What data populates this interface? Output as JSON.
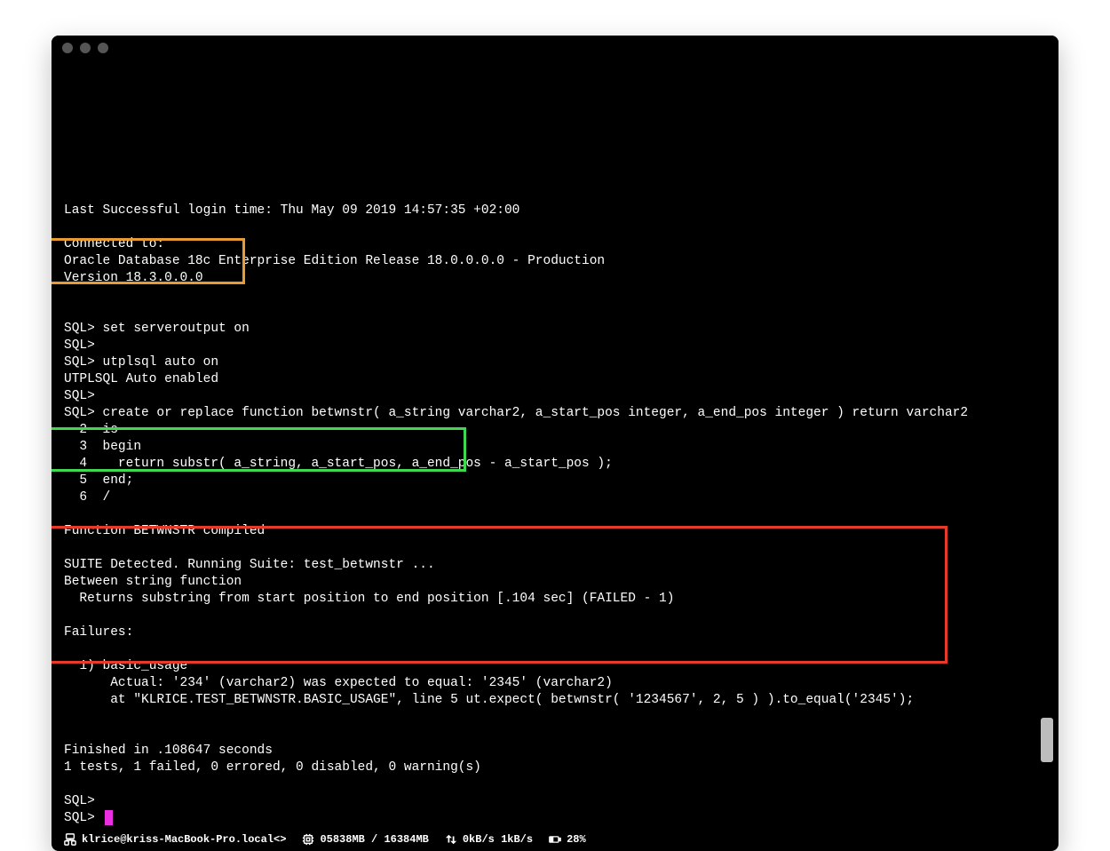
{
  "window": {
    "traffic_dots": 3
  },
  "terminal": {
    "lines": [
      "",
      "Last Successful login time: Thu May 09 2019 14:57:35 +02:00",
      "",
      "Connected to:",
      "Oracle Database 18c Enterprise Edition Release 18.0.0.0.0 - Production",
      "Version 18.3.0.0.0",
      "",
      "",
      "SQL> set serveroutput on",
      "SQL>",
      "SQL> utplsql auto on",
      "UTPLSQL Auto enabled",
      "SQL>",
      "SQL> create or replace function betwnstr( a_string varchar2, a_start_pos integer, a_end_pos integer ) return varchar2",
      "  2  is",
      "  3  begin",
      "  4    return substr( a_string, a_start_pos, a_end_pos - a_start_pos );",
      "  5  end;",
      "  6  /",
      "",
      "Function BETWNSTR compiled",
      "",
      "SUITE Detected. Running Suite: test_betwnstr ...",
      "Between string function",
      "  Returns substring from start position to end position [.104 sec] (FAILED - 1)",
      "",
      "Failures:",
      "",
      "  1) basic_usage",
      "      Actual: '234' (varchar2) was expected to equal: '2345' (varchar2)",
      "      at \"KLRICE.TEST_BETWNSTR.BASIC_USAGE\", line 5 ut.expect( betwnstr( '1234567', 2, 5 ) ).to_equal('2345');",
      "",
      "",
      "Finished in .108647 seconds",
      "1 tests, 1 failed, 0 errored, 0 disabled, 0 warning(s)",
      "",
      "SQL>",
      "SQL> "
    ],
    "cursor_visible": true
  },
  "highlights": {
    "orange": {
      "top_line": 10,
      "height_lines": 3,
      "label": "utplsql-auto-enable"
    },
    "green": {
      "top_line": 22,
      "height_lines": 2,
      "label": "suite-detected"
    },
    "red": {
      "top_line": 28,
      "height_lines": 8,
      "label": "failure-output"
    }
  },
  "statusbar": {
    "host": "klrice@kriss-MacBook-Pro.local<>",
    "memory": "05838MB / 16384MB",
    "net": "0kB/s 1kB/s",
    "battery": "28%"
  },
  "icons": {
    "host": "network-icon",
    "memory": "chip-icon",
    "net": "transfer-icon",
    "battery": "battery-icon"
  }
}
